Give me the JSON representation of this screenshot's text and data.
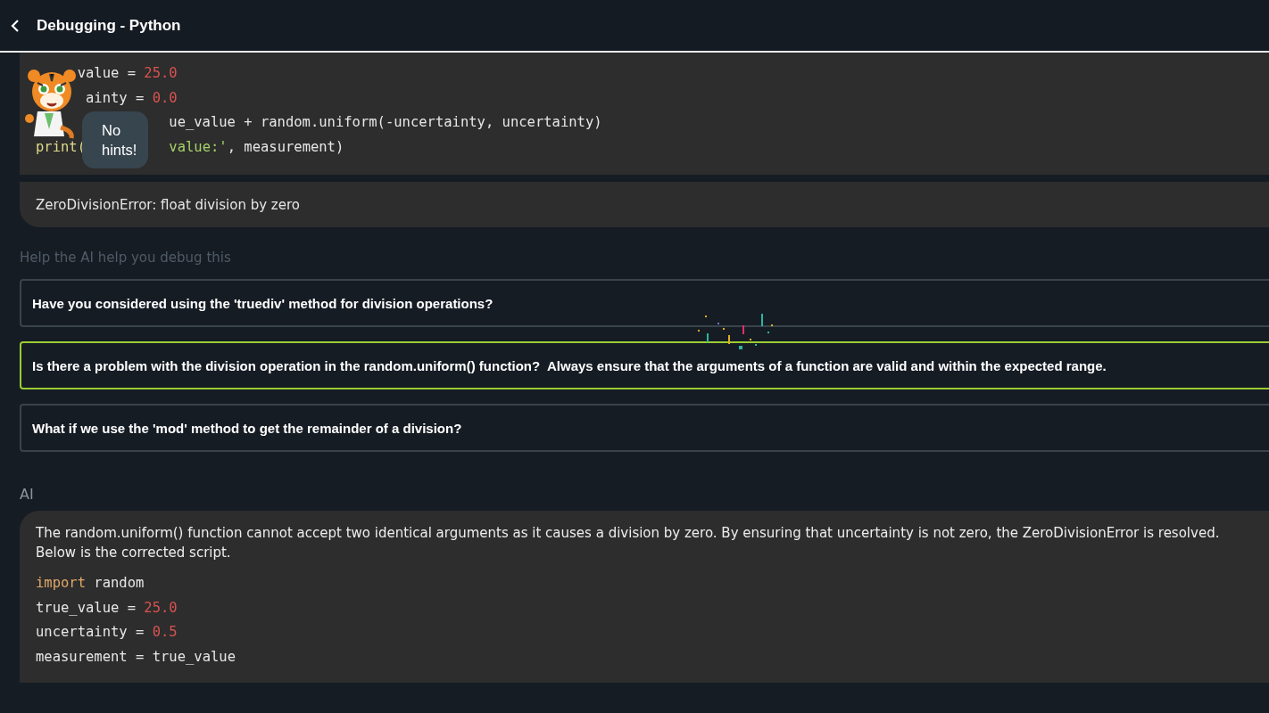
{
  "header": {
    "title": "Debugging - Python"
  },
  "code": {
    "lines": [
      [
        {
          "text": "value = ",
          "kind": "plain"
        },
        {
          "text": "25.0",
          "kind": "number"
        }
      ],
      [
        {
          "text": "ainty = ",
          "kind": "plain"
        },
        {
          "text": "0.0",
          "kind": "number"
        }
      ],
      [
        {
          "text": "ue_value + random.uniform(-uncertainty, uncertainty)",
          "kind": "plain"
        }
      ],
      [
        {
          "text": "print(",
          "kind": "builtin"
        },
        {
          "text": "value:'",
          "kind": "string"
        },
        {
          "text": ", measurement)",
          "kind": "plain"
        }
      ]
    ]
  },
  "error": "ZeroDivisionError: float division by zero",
  "mascot": {
    "hint": "No hints!"
  },
  "prompt": "Help the AI help you debug this",
  "options": [
    {
      "text": "Have you considered using the 'truediv' method for division operations?",
      "selected": false
    },
    {
      "text": "Is there a problem with the division operation in the random.uniform() function?  Always ensure that the arguments of a function are valid and within the expected range.",
      "selected": true
    },
    {
      "text": "What if we use the 'mod' method to get the remainder of a division?",
      "selected": false
    }
  ],
  "ai": {
    "label": "AI",
    "message": "The random.uniform() function cannot accept two identical arguments as it causes a division by zero. By ensuring that uncertainty is not zero, the ZeroDivisionError is resolved. Below is the corrected script.",
    "code": [
      [
        {
          "text": "import",
          "kind": "keyword"
        },
        {
          "text": " random",
          "kind": "plain"
        }
      ],
      [
        {
          "text": "true_value = ",
          "kind": "plain"
        },
        {
          "text": "25.0",
          "kind": "number"
        }
      ],
      [
        {
          "text": "uncertainty = ",
          "kind": "plain"
        },
        {
          "text": "0.5",
          "kind": "number"
        }
      ],
      [
        {
          "text": "measurement = true_value",
          "kind": "plain"
        }
      ]
    ]
  }
}
